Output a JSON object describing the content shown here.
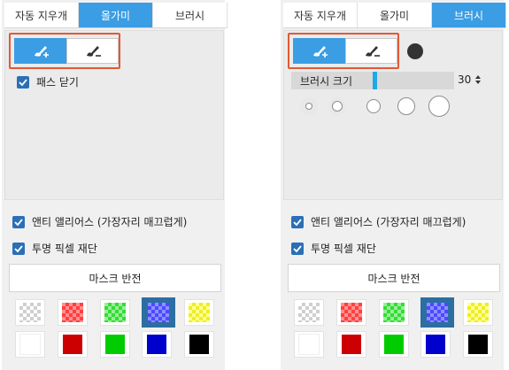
{
  "tabs": [
    "자동 지우개",
    "올가미",
    "브러시"
  ],
  "left_panel": {
    "active_tab": "올가미",
    "close_path_label": "패스 닫기"
  },
  "right_panel": {
    "active_tab": "브러시",
    "brush_size_label": "브러시 크기",
    "brush_size_value": "30",
    "brush_size_level": 0.43
  },
  "options": {
    "antialias_label": "앤티 앨리어스 (가장자리 매끄럽게)",
    "transparent_cut_label": "투명 픽셀 재단"
  },
  "invert_mask_label": "마스크 반전",
  "accent_color": "#3b9de3",
  "highlight_color": "#e05a36",
  "swatches_row1": [
    "transparent",
    "#ff0000",
    "#00cc00",
    "#0000ff",
    "#ffff00"
  ],
  "swatches_row2": [
    "#ffffff",
    "#cc0000",
    "#00cc00",
    "#0000cc",
    "#000000"
  ],
  "selected_swatch": 3,
  "icons": {
    "add": "brush-plus-icon",
    "remove": "brush-minus-icon",
    "check": "check-icon",
    "spinner": "spinner-arrows-icon"
  }
}
